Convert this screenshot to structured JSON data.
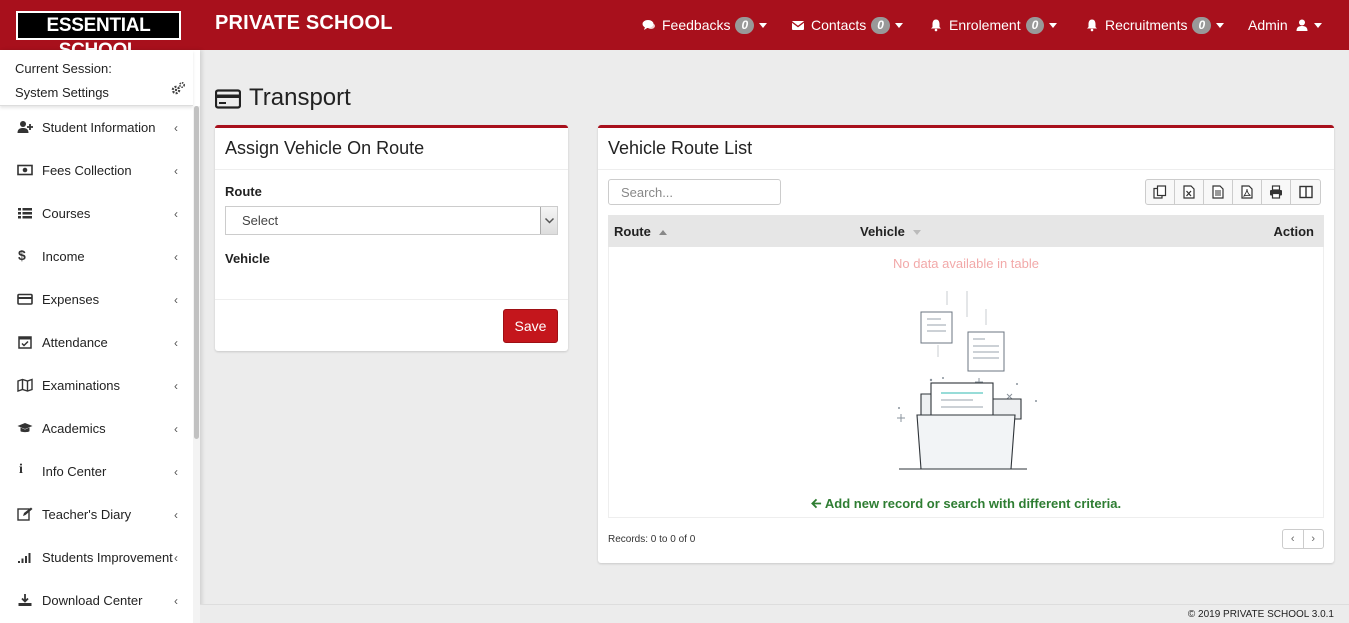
{
  "header": {
    "logo": "ESSENTIAL SCHOOL",
    "brand": "PRIVATE SCHOOL",
    "nav": [
      {
        "label": "Feedbacks",
        "count": "0",
        "icon": "comments-icon"
      },
      {
        "label": "Contacts",
        "count": "0",
        "icon": "envelope-icon"
      },
      {
        "label": "Enrolement",
        "count": "0",
        "icon": "bell-icon"
      },
      {
        "label": "Recruitments",
        "count": "0",
        "icon": "bell-icon"
      }
    ],
    "user": "Admin"
  },
  "sidebar": {
    "session_line1": "Current Session:",
    "session_line2": "System Settings",
    "items": [
      {
        "label": "Student Information",
        "icon": "user-plus-icon"
      },
      {
        "label": "Fees Collection",
        "icon": "money-icon"
      },
      {
        "label": "Courses",
        "icon": "list-icon"
      },
      {
        "label": "Income",
        "icon": "dollar-icon"
      },
      {
        "label": "Expenses",
        "icon": "credit-card-icon"
      },
      {
        "label": "Attendance",
        "icon": "calendar-check-icon"
      },
      {
        "label": "Examinations",
        "icon": "map-icon"
      },
      {
        "label": "Academics",
        "icon": "graduation-cap-icon"
      },
      {
        "label": "Info Center",
        "icon": "info-icon"
      },
      {
        "label": "Teacher's Diary",
        "icon": "edit-icon"
      },
      {
        "label": "Students Improvement",
        "icon": "signal-icon"
      },
      {
        "label": "Download Center",
        "icon": "download-icon"
      }
    ]
  },
  "page": {
    "title": "Transport"
  },
  "assign_box": {
    "title": "Assign Vehicle On Route",
    "route_label": "Route",
    "route_value": "Select",
    "vehicle_label": "Vehicle",
    "save_label": "Save"
  },
  "list_box": {
    "title": "Vehicle Route List",
    "search_placeholder": "Search...",
    "columns": [
      "Route",
      "Vehicle",
      "Action"
    ],
    "no_data": "No data available in table",
    "add_hint": "Add new record or search with different criteria.",
    "records": "Records: 0 to 0 of 0",
    "pager_prev": "‹",
    "pager_next": "›"
  },
  "footer": {
    "text": "© 2019 PRIVATE SCHOOL 3.0.1"
  },
  "colors": {
    "brand": "#a8101c",
    "save_button": "#c4161c",
    "hint_green": "#2e7d32",
    "nodata_pink": "#f2a9a9"
  }
}
